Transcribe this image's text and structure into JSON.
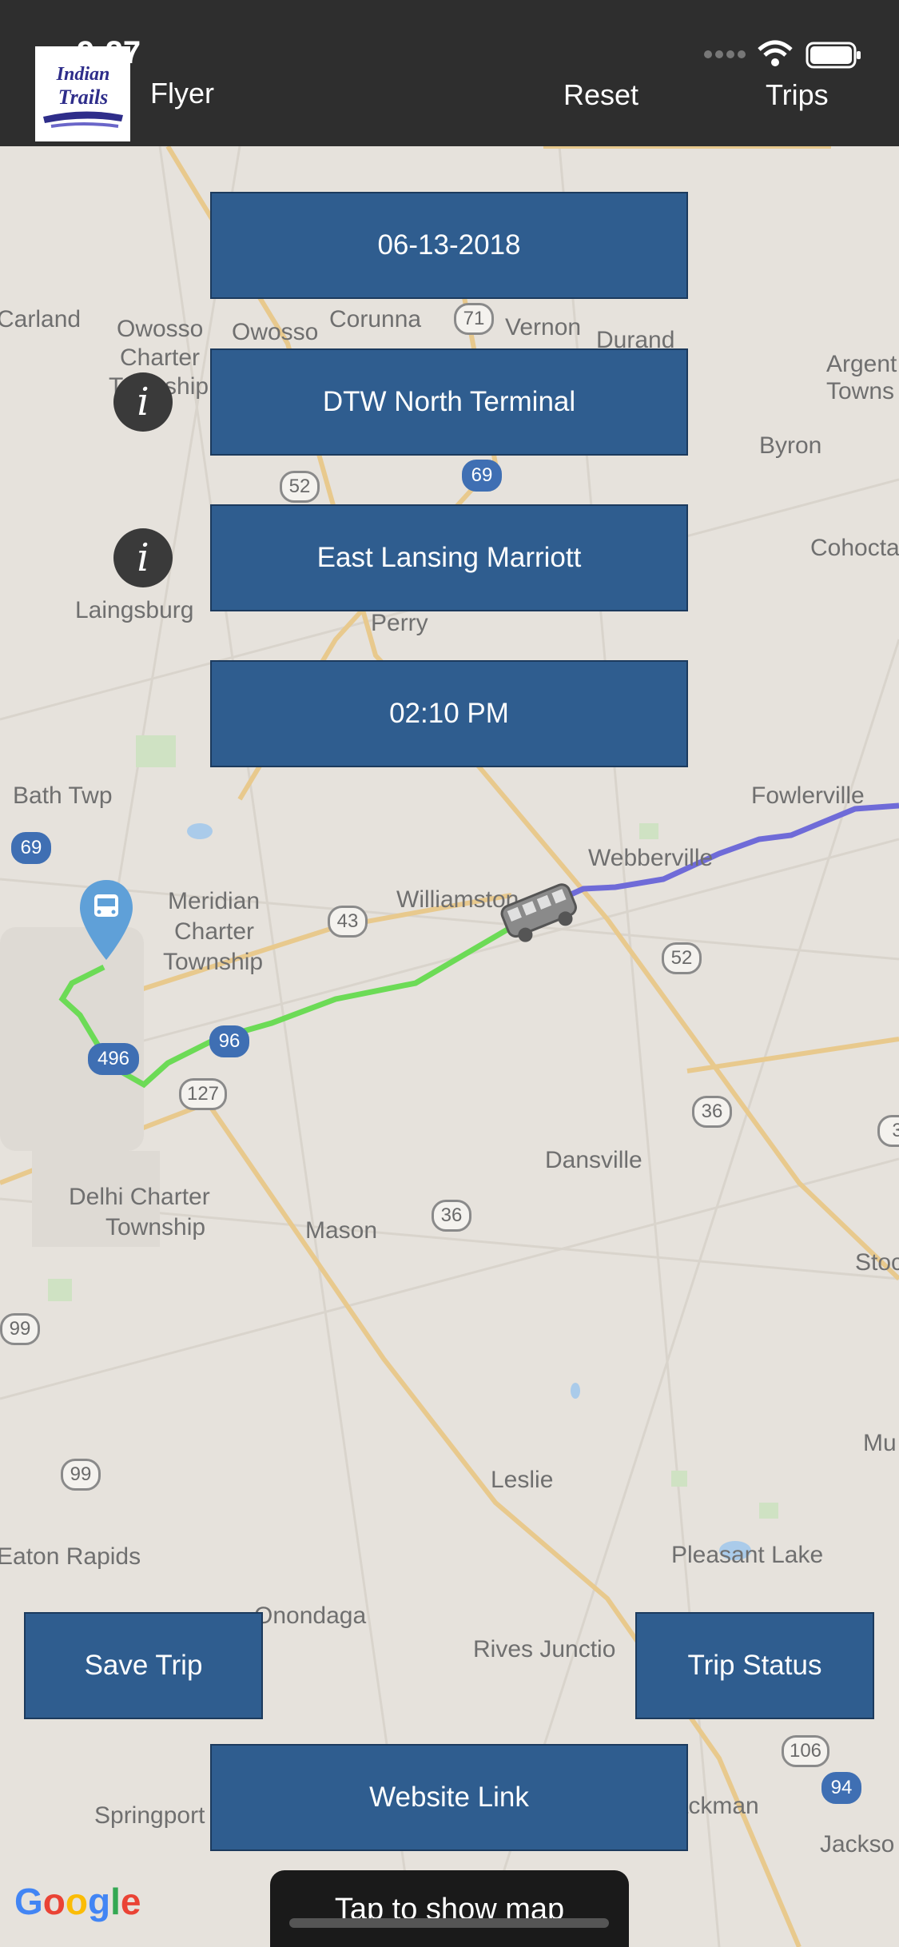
{
  "status_bar": {
    "time": "9:27",
    "signal_icon": "signal-dots-icon",
    "wifi_icon": "wifi-icon",
    "battery_icon": "battery-icon"
  },
  "header": {
    "logo_name": "Indian Trails",
    "title": "Flyer",
    "reset_label": "Reset",
    "trips_label": "Trips"
  },
  "form": {
    "date": "06-13-2018",
    "origin": "DTW North Terminal",
    "destination": "East Lansing Marriott",
    "time": "02:10 PM"
  },
  "info_icon_glyph": "i",
  "map": {
    "places": [
      "Carland",
      "Owosso",
      "Charter",
      "Township",
      "Owosso",
      "Corunna",
      "Vernon",
      "Durand",
      "Argent",
      "Towns",
      "Byron",
      "Cohocta",
      "Laingsburg",
      "Perry",
      "Bath Twp",
      "Fowlerville",
      "Webberville",
      "Meridian",
      "Charter",
      "Township",
      "Williamston",
      "Delhi Charter",
      "Township",
      "Dansville",
      "Mason",
      "Stoc",
      "Mu",
      "Leslie",
      "Eaton Rapids",
      "Pleasant Lake",
      "Onondaga",
      "Rives Junctio",
      "Springport",
      "Blackman",
      "Jackso"
    ],
    "shields": [
      "71",
      "69",
      "52",
      "69",
      "43",
      "52",
      "496",
      "96",
      "127",
      "36",
      "36",
      "99",
      "99",
      "106",
      "94",
      "3"
    ],
    "route_done_color": "#6cdb56",
    "route_remaining_color": "#6f6bd8",
    "bus_icon": "bus-icon",
    "pin_icon": "bus-stop-pin-icon"
  },
  "actions": {
    "save": "Save Trip",
    "status": "Trip Status",
    "website": "Website Link"
  },
  "toast": "Tap to show map",
  "brand": "Google"
}
